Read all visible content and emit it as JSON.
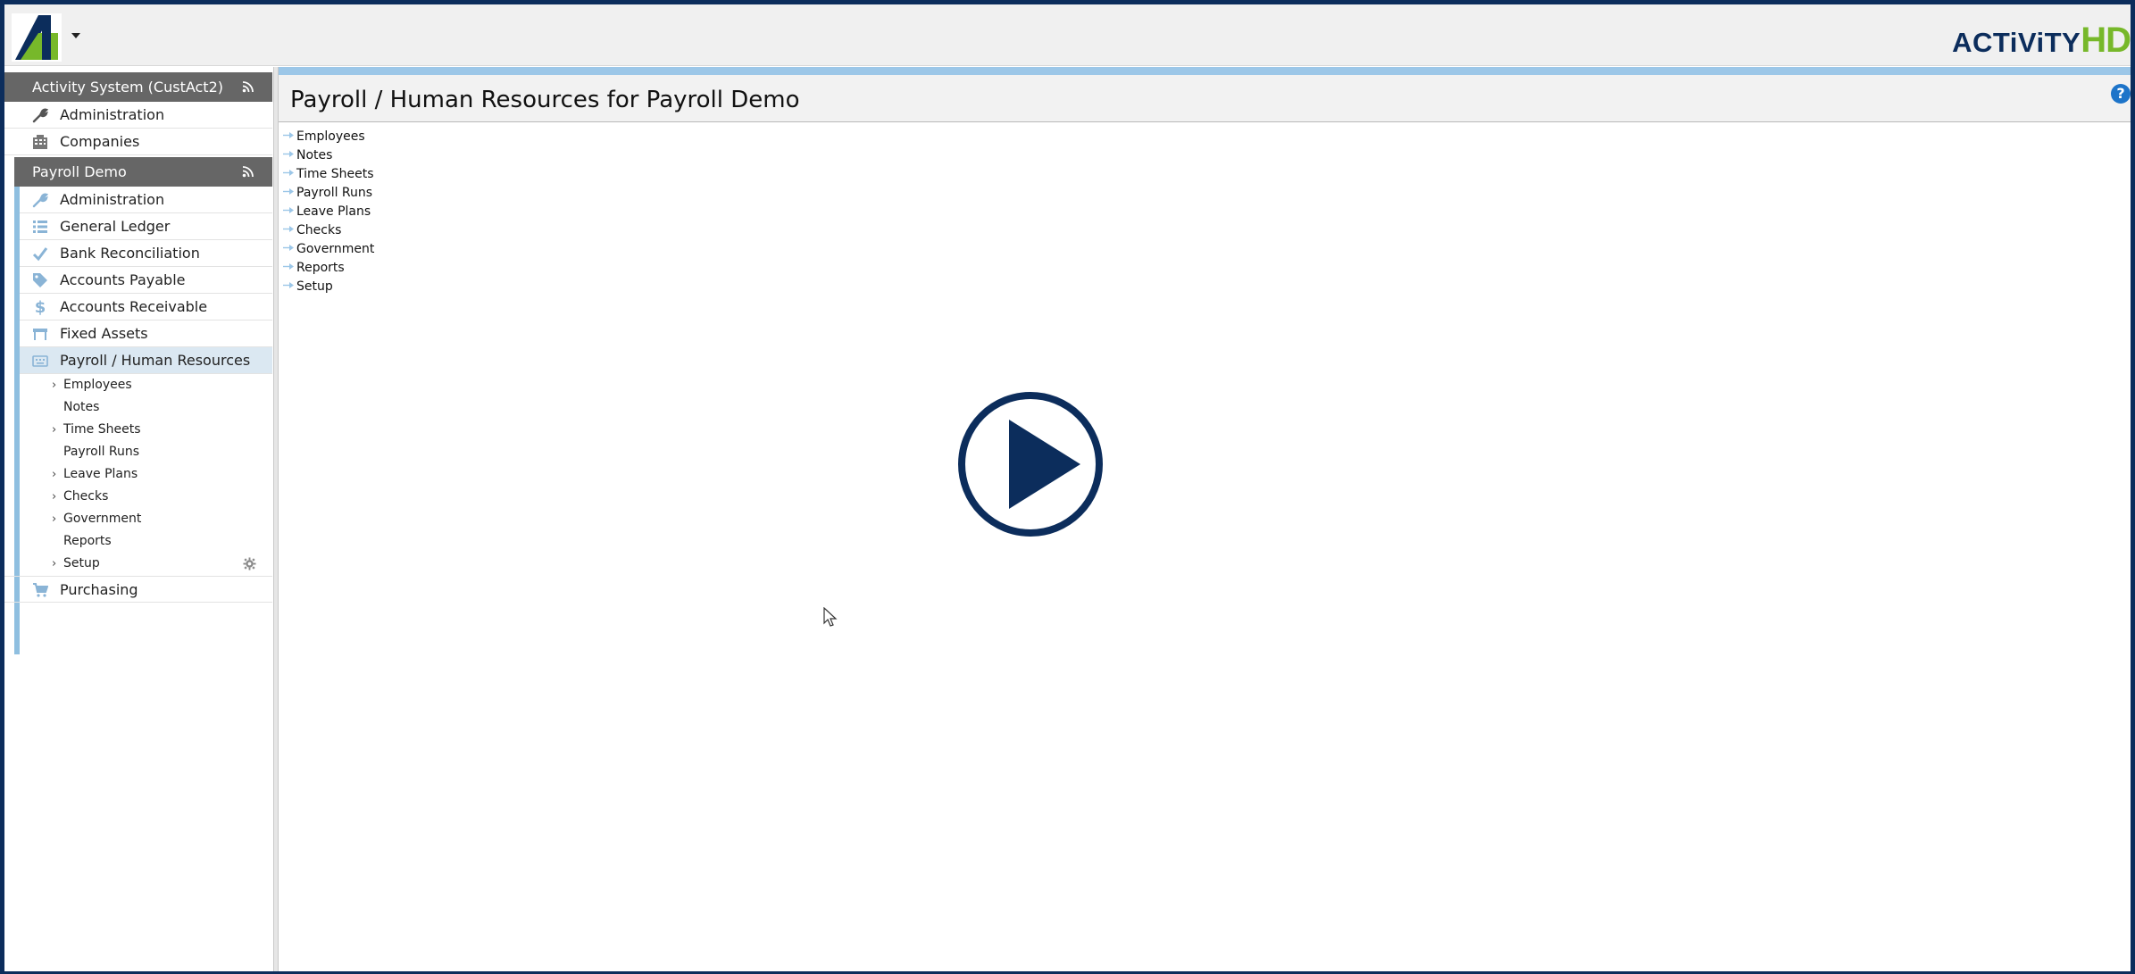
{
  "brand": {
    "part1": "ACTiViTY",
    "part2": "HD"
  },
  "sidebar": {
    "system_header": "Activity System (CustAct2)",
    "system_items": [
      {
        "label": "Administration",
        "icon": "wrench-icon"
      },
      {
        "label": "Companies",
        "icon": "building-icon"
      }
    ],
    "company_header": "Payroll Demo",
    "company_items": [
      {
        "label": "Administration",
        "icon": "wrench-icon"
      },
      {
        "label": "General Ledger",
        "icon": "list-icon"
      },
      {
        "label": "Bank Reconciliation",
        "icon": "check-icon"
      },
      {
        "label": "Accounts Payable",
        "icon": "tag-icon"
      },
      {
        "label": "Accounts Receivable",
        "icon": "dollar-icon"
      },
      {
        "label": "Fixed Assets",
        "icon": "table-icon"
      },
      {
        "label": "Payroll / Human Resources",
        "icon": "keyboard-icon"
      }
    ],
    "payroll_subitems": [
      {
        "label": "Employees",
        "expandable": true
      },
      {
        "label": "Notes",
        "expandable": false
      },
      {
        "label": "Time Sheets",
        "expandable": true
      },
      {
        "label": "Payroll Runs",
        "expandable": false
      },
      {
        "label": "Leave Plans",
        "expandable": true
      },
      {
        "label": "Checks",
        "expandable": true
      },
      {
        "label": "Government",
        "expandable": true
      },
      {
        "label": "Reports",
        "expandable": false
      },
      {
        "label": "Setup",
        "expandable": true
      }
    ],
    "after_items": [
      {
        "label": "Purchasing",
        "icon": "cart-icon"
      }
    ]
  },
  "main": {
    "title": "Payroll / Human Resources for Payroll Demo",
    "help": "?",
    "tree": [
      "Employees",
      "Notes",
      "Time Sheets",
      "Payroll Runs",
      "Leave Plans",
      "Checks",
      "Government",
      "Reports",
      "Setup"
    ]
  },
  "colors": {
    "frame": "#0c2d5c",
    "brand_green": "#77b82a",
    "header_gray": "#666666",
    "accent_blue": "#9cc7e8"
  }
}
